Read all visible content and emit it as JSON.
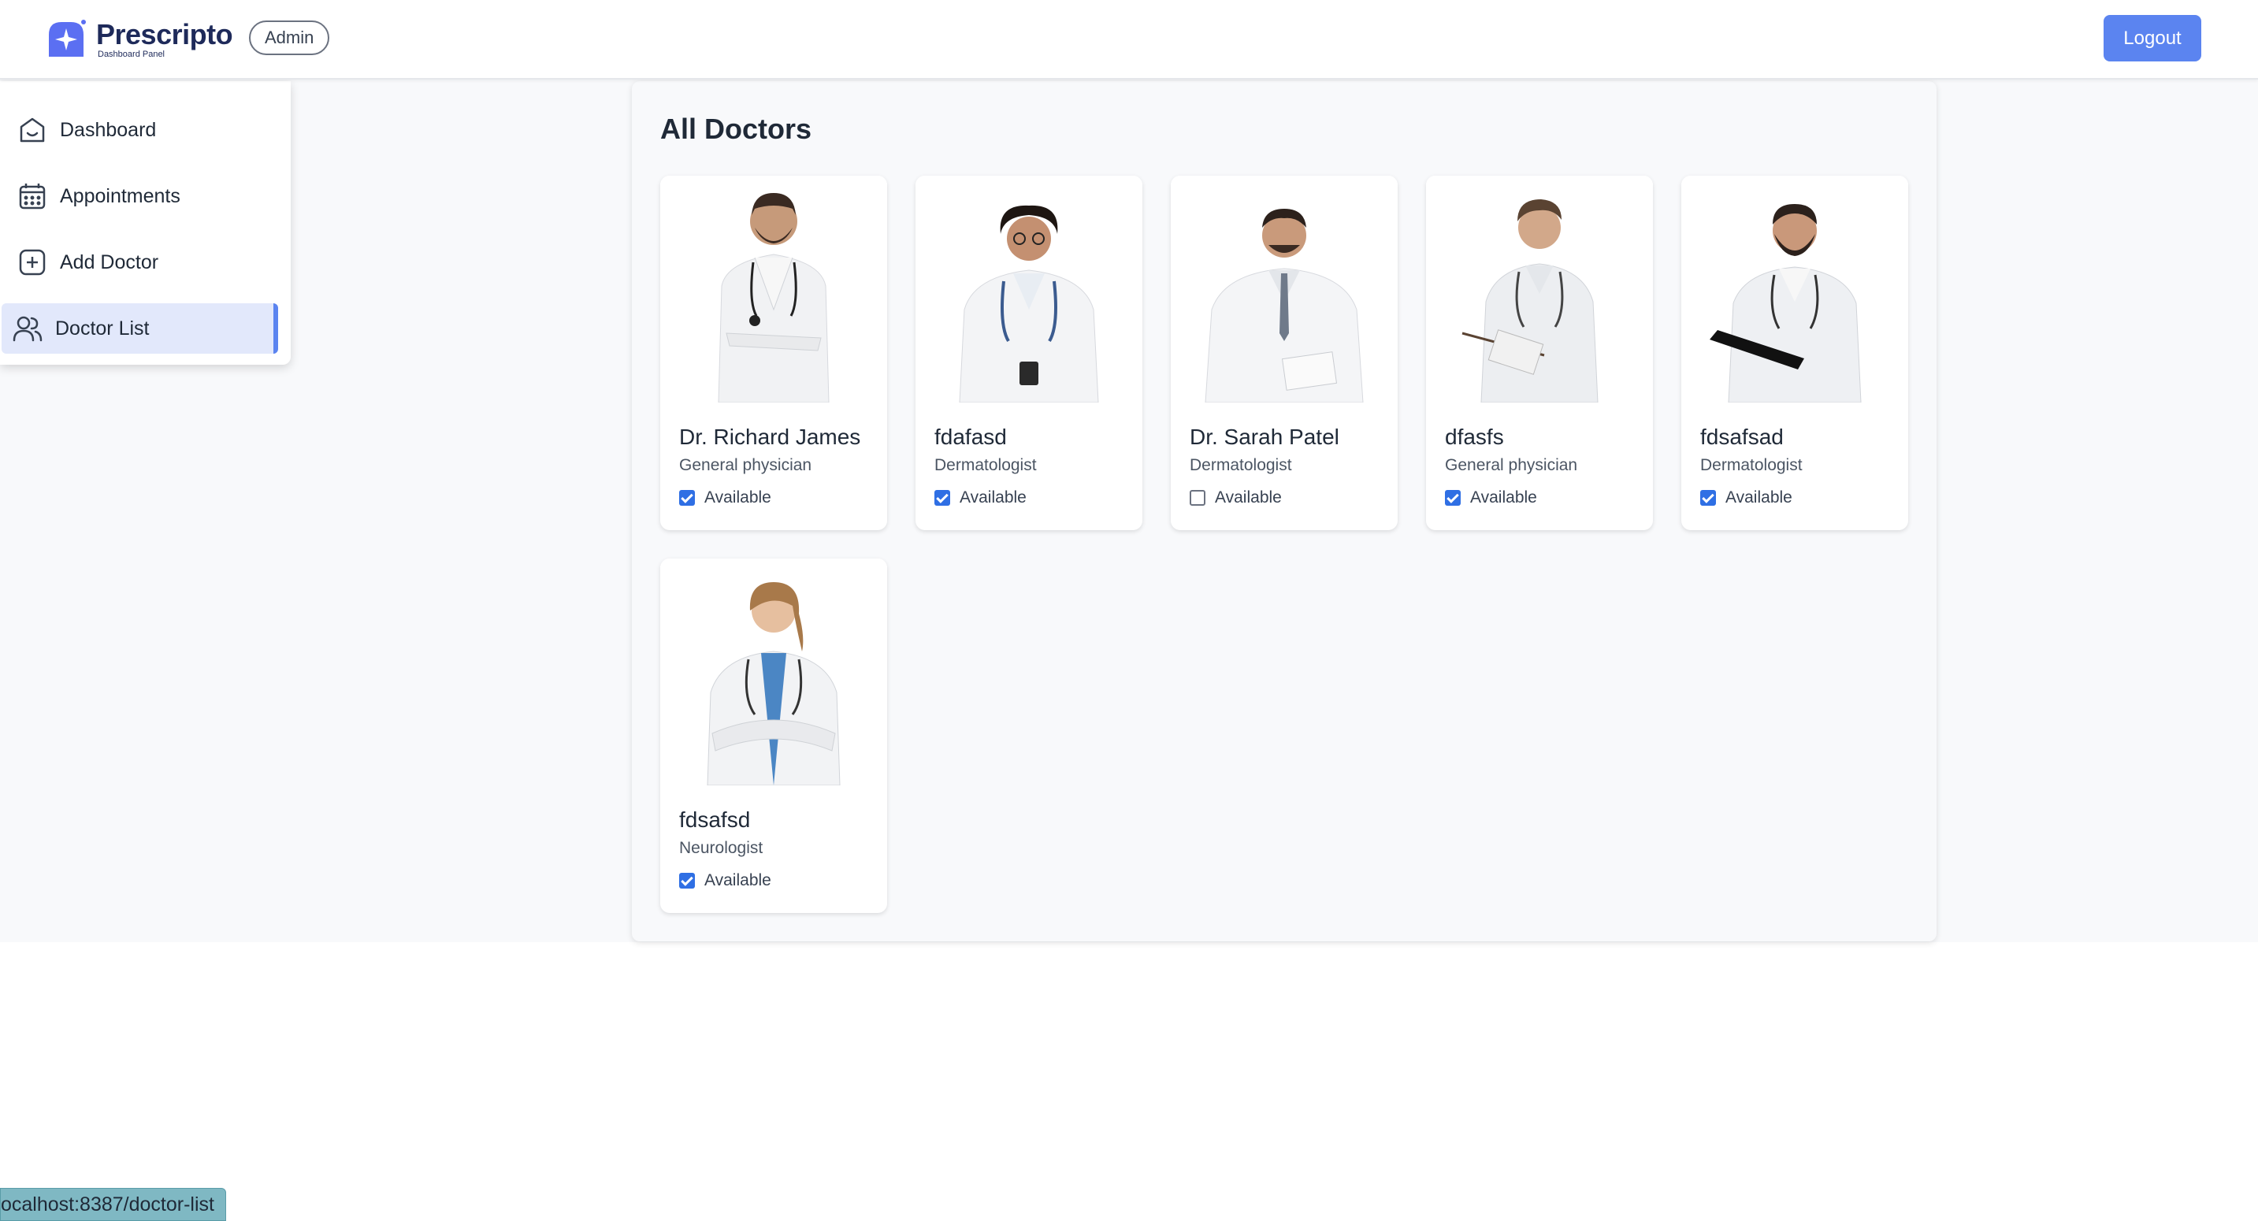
{
  "header": {
    "brand_name": "Prescripto",
    "brand_sub": "Dashboard Panel",
    "role_badge": "Admin",
    "logout_label": "Logout",
    "accent_color": "#5b84f0"
  },
  "sidebar": {
    "items": [
      {
        "label": "Dashboard",
        "icon": "home-icon",
        "active": false
      },
      {
        "label": "Appointments",
        "icon": "calendar-icon",
        "active": false
      },
      {
        "label": "Add Doctor",
        "icon": "add-square-icon",
        "active": false
      },
      {
        "label": "Doctor List",
        "icon": "people-icon",
        "active": true
      }
    ]
  },
  "main": {
    "title": "All Doctors",
    "doctors": [
      {
        "name": "Dr. Richard James",
        "speciality": "General physician",
        "available_label": "Available",
        "available": true
      },
      {
        "name": "fdafasd",
        "speciality": "Dermatologist",
        "available_label": "Available",
        "available": true
      },
      {
        "name": "Dr. Sarah Patel",
        "speciality": "Dermatologist",
        "available_label": "Available",
        "available": false
      },
      {
        "name": "dfasfs",
        "speciality": "General physician",
        "available_label": "Available",
        "available": true
      },
      {
        "name": "fdsafsad",
        "speciality": "Dermatologist",
        "available_label": "Available",
        "available": true
      },
      {
        "name": "fdsafsd",
        "speciality": "Neurologist",
        "available_label": "Available",
        "available": true
      }
    ]
  },
  "status_bar": {
    "url": "ocalhost:8387/doctor-list"
  }
}
